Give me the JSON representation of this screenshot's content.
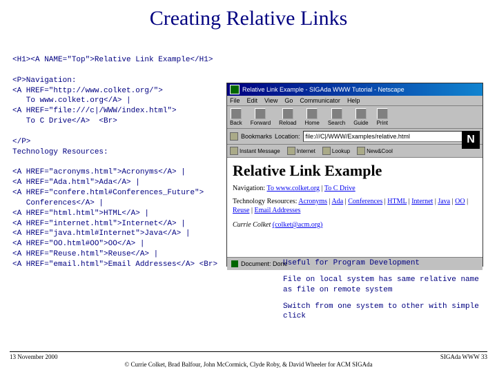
{
  "title": "Creating Relative Links",
  "code": [
    "<H1><A NAME=\"Top\">Relative Link Example</H1>",
    "",
    "<P>Navigation:",
    "<A HREF=\"http://www.colket.org/\">",
    "   To www.colket.org</A> |",
    "<A HREF=\"file:///c|/WWW/index.html\">",
    "   To C Drive</A>  <Br>",
    "",
    "</P>",
    "Technology Resources:",
    "",
    "<A HREF=\"acronyms.html\">Acronyms</A> |",
    "<A HREF=\"Ada.html\">Ada</A> |",
    "<A HREF=\"confere.html#Conferences_Future\">",
    "   Conferences</A> |",
    "<A HREF=\"html.html\">HTML</A> |",
    "<A HREF=\"internet.html\">Internet</A> |",
    "<A HREF=\"java.html#Internet\">Java</A> |",
    "<A HREF=\"OO.html#OO\">OO</A> |",
    "<A HREF=\"Reuse.html\">Reuse</A> |",
    "<A HREF=\"email.html\">Email Addresses</A> <Br>"
  ],
  "browser": {
    "title": "Relative Link Example - SIGAda WWW Tutorial - Netscape",
    "menu": [
      "File",
      "Edit",
      "View",
      "Go",
      "Communicator",
      "Help"
    ],
    "toolbar": [
      "Back",
      "Forward",
      "Reload",
      "Home",
      "Search",
      "Guide",
      "Print"
    ],
    "bookmarks_label": "Bookmarks",
    "location_label": "Location:",
    "location_value": "file:///C|/WWW/Examples/relative.html",
    "toolbar2": [
      "Instant Message",
      "Internet",
      "Lookup",
      "New&Cool"
    ],
    "n_logo": "N",
    "page": {
      "h1": "Relative Link Example",
      "nav_label": "Navigation:",
      "nav_link1": "To www.colket.org",
      "nav_link2": "To C Drive",
      "tech_label": "Technology Resources:",
      "links": [
        "Acronyms",
        "Ada",
        "Conferences",
        "HTML",
        "Internet",
        "Java",
        "OO",
        "Reuse",
        "Email Addresses"
      ],
      "author": "Currie Colket",
      "email": "(colket@acm.org)"
    },
    "status": "Document: Done"
  },
  "notes": {
    "n1": "Useful for Program Development",
    "n2": "File on local system has same relative name as file on remote system",
    "n3": "Switch from one system to other with simple click"
  },
  "footer": {
    "date": "13 November 2000",
    "right": "SIGAda WWW 33",
    "copyright": "© Currie Colket, Brad Balfour, John McCormick, Clyde Roby, & David Wheeler for ACM SIGAda"
  }
}
